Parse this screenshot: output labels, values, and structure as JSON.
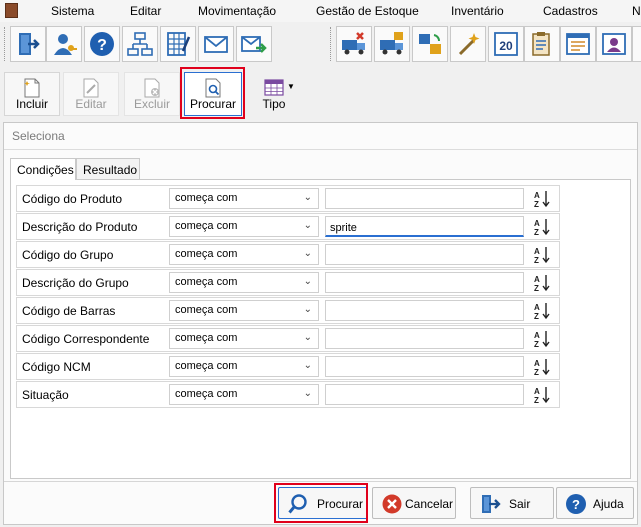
{
  "menu": [
    "Sistema",
    "Editar",
    "Movimentação",
    "Gestão de Estoque",
    "Inventário",
    "Cadastros",
    "N"
  ],
  "toolbar_icons": [
    "exit-door-icon",
    "user-key-icon",
    "help-circle-icon",
    "org-chart-icon",
    "calculator-grid-icon",
    "envelope-icon",
    "mail-forward-icon",
    "truck-cancel-icon",
    "truck-box-icon",
    "transfer-boxes-icon",
    "sparkle-tool-icon",
    "calendar-20-icon",
    "clipboard-doc-icon",
    "form-window-icon",
    "person-card-icon",
    "document-report-icon"
  ],
  "actions": {
    "incluir": "Incluir",
    "editar": "Editar",
    "excluir": "Excluir",
    "procurar": "Procurar",
    "tipo": "Tipo"
  },
  "panel": {
    "title": "Seleciona",
    "tabs": [
      "Condições",
      "Resultado"
    ]
  },
  "conditions": [
    {
      "label": "Código do Produto",
      "operator": "começa com",
      "value": ""
    },
    {
      "label": "Descrição do Produto",
      "operator": "começa com",
      "value": "sprite"
    },
    {
      "label": "Código do Grupo",
      "operator": "começa com",
      "value": ""
    },
    {
      "label": "Descrição do Grupo",
      "operator": "começa com",
      "value": ""
    },
    {
      "label": "Código de Barras",
      "operator": "começa com",
      "value": ""
    },
    {
      "label": "Código Correspondente",
      "operator": "começa com",
      "value": ""
    },
    {
      "label": "Código NCM",
      "operator": "começa com",
      "value": ""
    },
    {
      "label": "Situação",
      "operator": "começa com",
      "value": ""
    }
  ],
  "buttons": {
    "procurar": "Procurar",
    "cancelar": "Cancelar",
    "sair": "Sair",
    "ajuda": "Ajuda"
  },
  "colors": {
    "highlight": "#e0001b",
    "focus": "#2a6fd1",
    "help_blue": "#1f5fb0",
    "cancel_red": "#d23a2a"
  }
}
